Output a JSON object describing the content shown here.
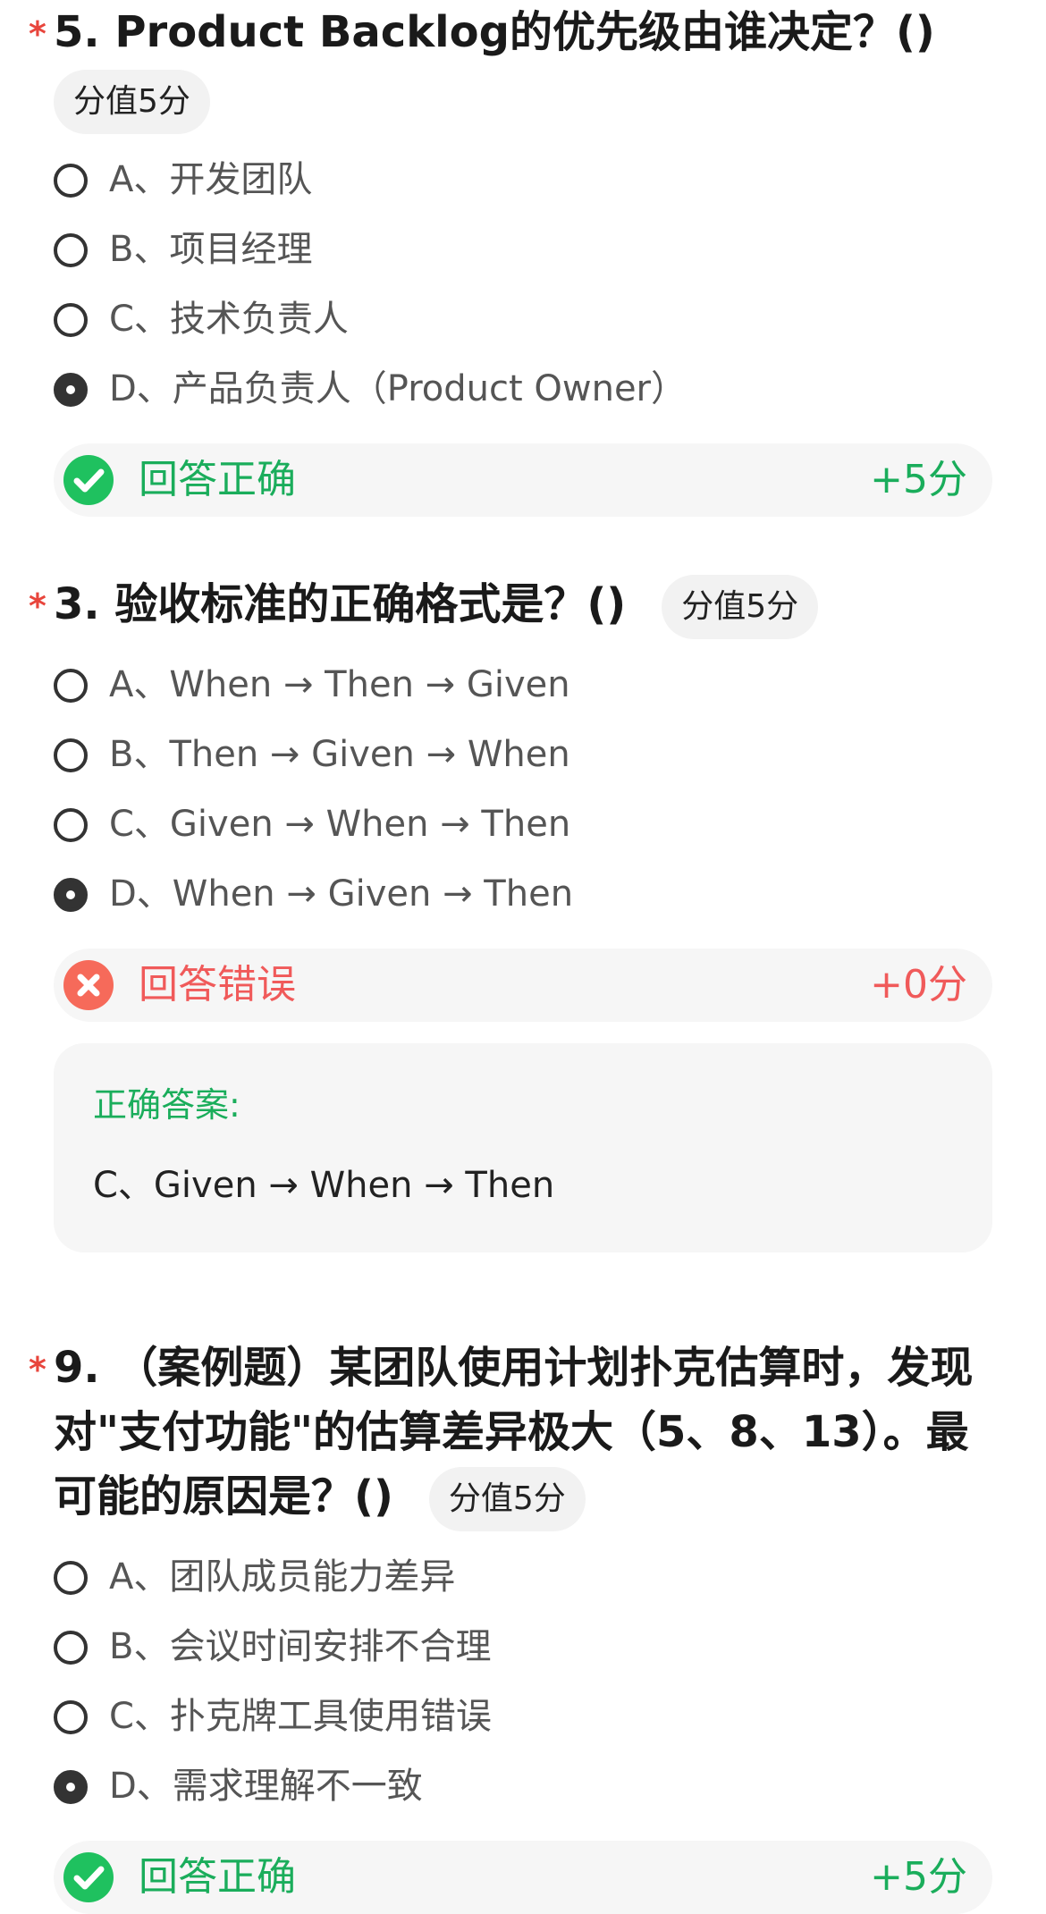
{
  "required_mark": "*",
  "score_tag": "分值5分",
  "colors": {
    "correct": "#1aad5b",
    "wrong": "#f05a5a",
    "required": "#e8453c"
  },
  "questions": [
    {
      "title": "5. Product Backlog的优先级由谁决定？()",
      "options": [
        "A、开发团队",
        "B、项目经理",
        "C、技术负责人",
        "D、产品负责人（Product Owner）"
      ],
      "selected": "D",
      "result": {
        "status": "correct",
        "label": "回答正确",
        "score": "+5分",
        "icon": "check-circle-icon"
      }
    },
    {
      "title": "3. 验收标准的正确格式是？()",
      "options": [
        "A、When → Then → Given",
        "B、Then → Given → When",
        "C、Given → When → Then",
        "D、When → Given → Then"
      ],
      "selected": "D",
      "result": {
        "status": "wrong",
        "label": "回答错误",
        "score": "+0分",
        "icon": "cross-circle-icon"
      },
      "correct_answer": {
        "title": "正确答案:",
        "text": "C、Given → When → Then"
      }
    },
    {
      "title": "9. （案例题）某团队使用计划扑克估算时，发现对\"支付功能\"的估算差异极大（5、8、13）。最可能的原因是？()",
      "options": [
        "A、团队成员能力差异",
        "B、会议时间安排不合理",
        "C、扑克牌工具使用错误",
        "D、需求理解不一致"
      ],
      "selected": "D",
      "result": {
        "status": "correct",
        "label": "回答正确",
        "score": "+5分",
        "icon": "check-circle-icon"
      }
    }
  ]
}
